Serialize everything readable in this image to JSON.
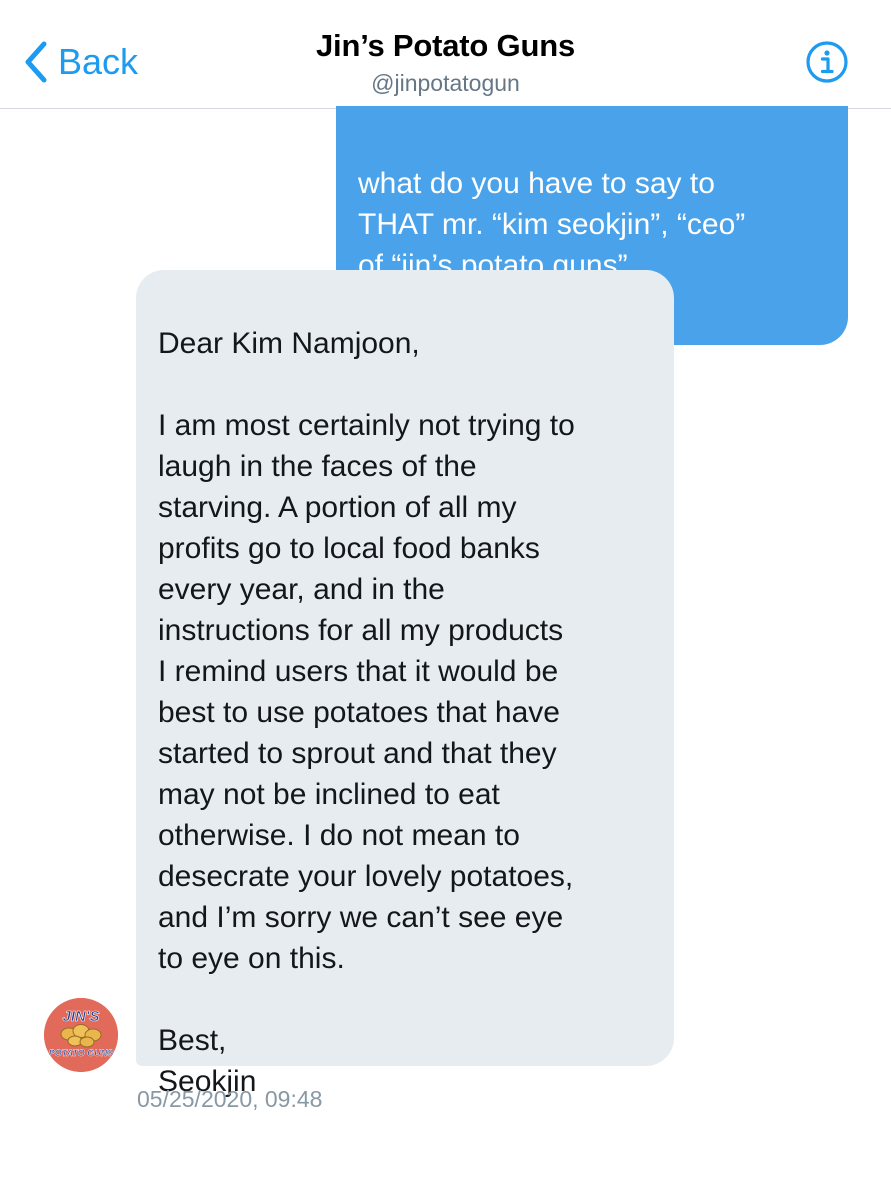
{
  "header": {
    "back_label": "Back",
    "title": "Jin’s Potato Guns",
    "handle": "@jinpotatogun"
  },
  "messages": [
    {
      "direction": "outgoing",
      "text": "what do you have to say to\nTHAT mr. “kim seokjin”, “ceo”\nof “jin’s potato guns”"
    },
    {
      "direction": "incoming",
      "text": "Dear Kim Namjoon,\n\nI am most certainly not trying to\nlaugh in the faces of the\nstarving. A portion of all my\nprofits go to local food banks\nevery year, and in the\ninstructions for all my products\nI remind users that it would be\nbest to use potatoes that have\nstarted to sprout and that they\nmay not be inclined to eat\notherwise. I do not mean to\ndesecrate your lovely potatoes,\nand I’m sorry we can’t see eye\nto eye on this.\n\nBest,\nSeokjin",
      "timestamp": "05/25/2020, 09:48"
    }
  ],
  "avatar": {
    "logo_text_top": "JIN'S",
    "logo_text_bottom": "POTATO GUNS"
  },
  "colors": {
    "accent": "#1d9bf0",
    "outgoing_bubble": "#4aa3ea",
    "incoming_bubble": "#e6ecf0",
    "avatar_bg": "#e26a5a"
  },
  "icons": {
    "back": "chevron-left-icon",
    "info": "info-circle-icon"
  }
}
